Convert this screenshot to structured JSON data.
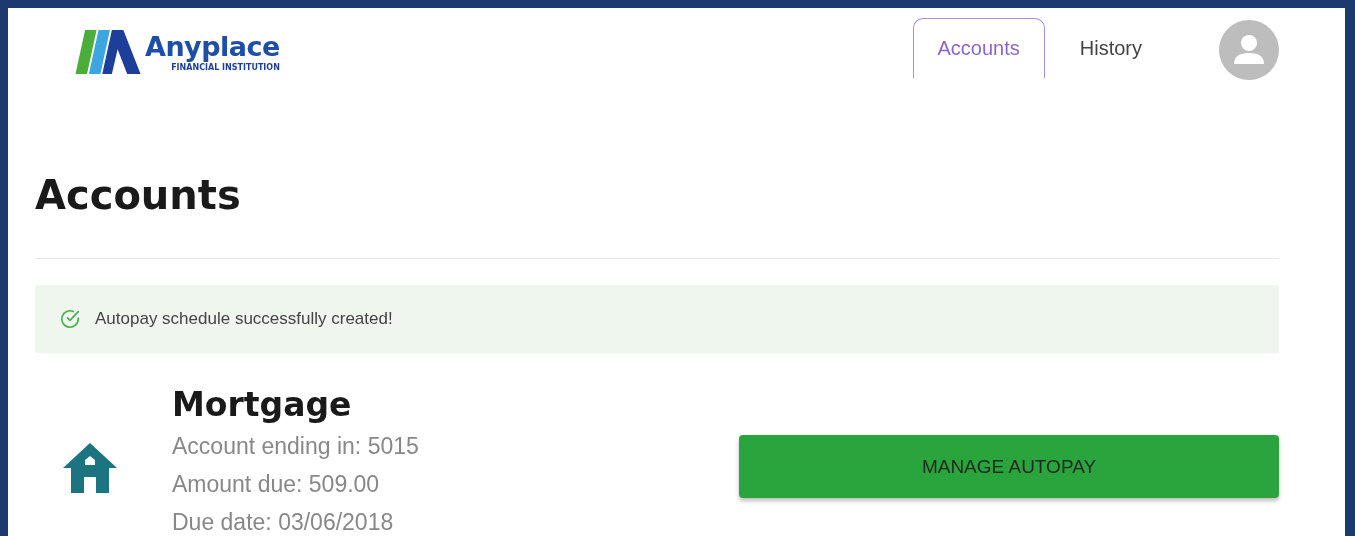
{
  "logo": {
    "name": "Anyplace",
    "tagline": "FINANCIAL INSTITUTION"
  },
  "tabs": [
    {
      "label": "Accounts",
      "selected": true
    },
    {
      "label": "History",
      "selected": false
    }
  ],
  "page_title": "Accounts",
  "alert": {
    "kind": "success",
    "message": "Autopay schedule successfully created!"
  },
  "accounts": [
    {
      "kind": "mortgage",
      "name": "Mortgage",
      "details": [
        "Account ending in: 5015",
        "Amount due: 509.00",
        "Due date: 03/06/2018"
      ],
      "button": "MANAGE AUTOPAY"
    }
  ]
}
